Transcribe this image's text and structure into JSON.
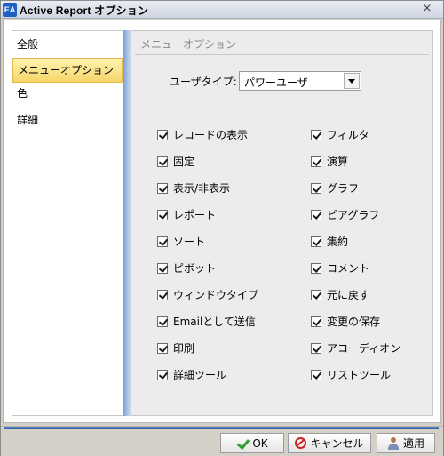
{
  "window": {
    "title": "Active Report オプション",
    "icon": "EA",
    "close_glyph": "×"
  },
  "sidebar": {
    "items": [
      {
        "label": "全般",
        "selected": false
      },
      {
        "label": "メニューオプション",
        "selected": true
      },
      {
        "label": "色",
        "selected": false
      },
      {
        "label": "詳細",
        "selected": false
      }
    ]
  },
  "panel": {
    "title": "メニューオプション",
    "user_type_label": "ユーザタイプ:",
    "user_type_value": "パワーユーザ"
  },
  "options_left": [
    {
      "label": "レコードの表示",
      "checked": true
    },
    {
      "label": "固定",
      "checked": true
    },
    {
      "label": "表示/非表示",
      "checked": true
    },
    {
      "label": "レポート",
      "checked": true
    },
    {
      "label": "ソート",
      "checked": true
    },
    {
      "label": "ピボット",
      "checked": true
    },
    {
      "label": "ウィンドウタイプ",
      "checked": true
    },
    {
      "label": "Emailとして送信",
      "checked": true
    },
    {
      "label": "印刷",
      "checked": true
    },
    {
      "label": "詳細ツール",
      "checked": true
    }
  ],
  "options_right": [
    {
      "label": "フィルタ",
      "checked": true
    },
    {
      "label": "演算",
      "checked": true
    },
    {
      "label": "グラフ",
      "checked": true
    },
    {
      "label": "ピアグラフ",
      "checked": true
    },
    {
      "label": "集約",
      "checked": true
    },
    {
      "label": "コメント",
      "checked": true
    },
    {
      "label": "元に戻す",
      "checked": true
    },
    {
      "label": "変更の保存",
      "checked": true
    },
    {
      "label": "アコーディオン",
      "checked": true
    },
    {
      "label": "リストツール",
      "checked": true
    }
  ],
  "buttons": {
    "ok": "OK",
    "cancel": "キャンセル",
    "apply": "適用"
  }
}
